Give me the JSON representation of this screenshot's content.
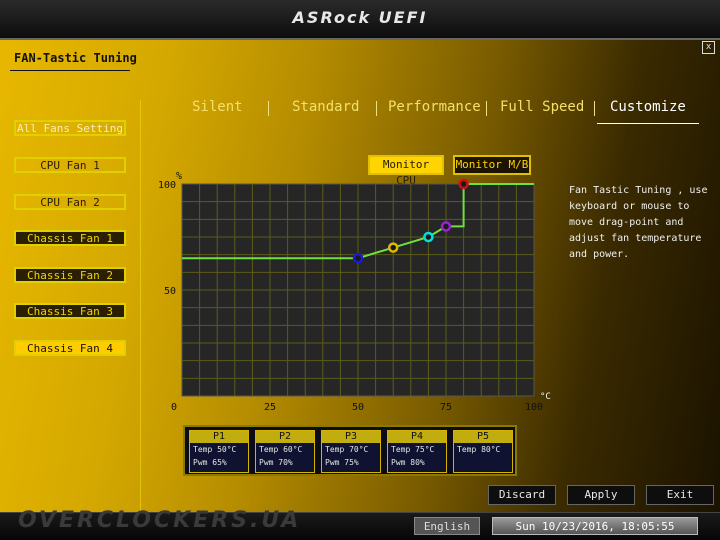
{
  "header": {
    "brand": "ASRock UEFI"
  },
  "close_icon_label": "x",
  "page_title": "FAN-Tastic Tuning",
  "sidebar": {
    "items": [
      {
        "label": "All Fans Setting"
      },
      {
        "label": "CPU Fan 1"
      },
      {
        "label": "CPU Fan 2"
      },
      {
        "label": "Chassis Fan 1"
      },
      {
        "label": "Chassis Fan 2"
      },
      {
        "label": "Chassis Fan 3"
      },
      {
        "label": "Chassis Fan 4"
      }
    ],
    "selected": "Chassis Fan 4"
  },
  "tabs": [
    {
      "label": "Silent"
    },
    {
      "label": "Standard"
    },
    {
      "label": "Performance"
    },
    {
      "label": "Full Speed"
    },
    {
      "label": "Customize"
    }
  ],
  "active_tab": "Customize",
  "monitor": {
    "cpu_label": "Monitor CPU",
    "mb_label": "Monitor M/B"
  },
  "help_text": [
    "Fan Tastic Tuning , use",
    "keyboard or mouse to",
    "move drag-point and",
    "adjust fan temperature",
    "and power."
  ],
  "chart_data": {
    "type": "line",
    "x_unit": "°C",
    "y_unit": "%",
    "xlim": [
      0,
      100
    ],
    "ylim": [
      0,
      100
    ],
    "x_ticks": [
      "0",
      "25",
      "50",
      "75",
      "100"
    ],
    "y_ticks": [
      "50",
      "100"
    ],
    "grid": true,
    "curve": [
      [
        0,
        65
      ],
      [
        50,
        65
      ],
      [
        60,
        70
      ],
      [
        70,
        75
      ],
      [
        75,
        80
      ],
      [
        80,
        80
      ],
      [
        80,
        100
      ],
      [
        100,
        100
      ]
    ],
    "points": [
      {
        "name": "P1",
        "temp": 50,
        "pwm": 65,
        "color": "#1a1ad8"
      },
      {
        "name": "P2",
        "temp": 60,
        "pwm": 70,
        "color": "#e0b800"
      },
      {
        "name": "P3",
        "temp": 70,
        "pwm": 75,
        "color": "#00e0e0"
      },
      {
        "name": "P4",
        "temp": 75,
        "pwm": 80,
        "color": "#9a20d0"
      },
      {
        "name": "P5",
        "temp": 80,
        "pwm": 100,
        "color": "#d01010"
      }
    ]
  },
  "points_table": [
    {
      "name": "P1",
      "temp": "Temp 50°C",
      "pwm": "Pwm  65%"
    },
    {
      "name": "P2",
      "temp": "Temp 60°C",
      "pwm": "Pwm  70%"
    },
    {
      "name": "P3",
      "temp": "Temp 70°C",
      "pwm": "Pwm  75%"
    },
    {
      "name": "P4",
      "temp": "Temp 75°C",
      "pwm": "Pwm  80%"
    },
    {
      "name": "P5",
      "temp": "Temp 80°C",
      "pwm": ""
    }
  ],
  "actions": {
    "discard": "Discard",
    "apply": "Apply",
    "exit": "Exit"
  },
  "footer": {
    "language": "English",
    "datetime": "Sun 10/23/2016, 18:05:55",
    "watermark": "OVERCLOCKERS.UA"
  }
}
